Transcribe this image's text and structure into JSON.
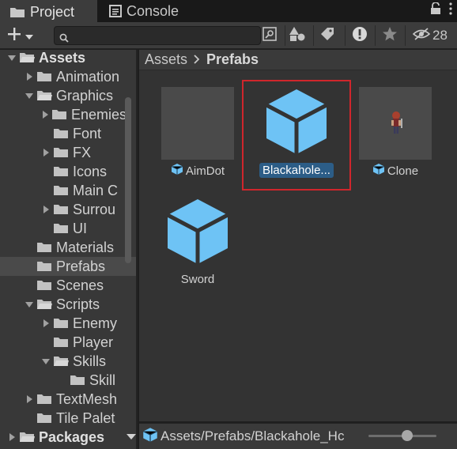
{
  "tabs": {
    "project_label": "Project",
    "console_label": "Console"
  },
  "toolbar": {
    "create_label": "+",
    "search_placeholder": "",
    "hidden_count": "28"
  },
  "tree": {
    "items": [
      {
        "label": "Assets"
      },
      {
        "label": "Animation"
      },
      {
        "label": "Graphics"
      },
      {
        "label": "Enemies"
      },
      {
        "label": "Font"
      },
      {
        "label": "FX"
      },
      {
        "label": "Icons"
      },
      {
        "label": "Main C"
      },
      {
        "label": "Surrou"
      },
      {
        "label": "UI"
      },
      {
        "label": "Materials"
      },
      {
        "label": "Prefabs"
      },
      {
        "label": "Scenes"
      },
      {
        "label": "Scripts"
      },
      {
        "label": "Enemy"
      },
      {
        "label": "Player"
      },
      {
        "label": "Skills"
      },
      {
        "label": "Skill"
      },
      {
        "label": "TextMesh"
      },
      {
        "label": "Tile Palet"
      },
      {
        "label": "Packages"
      }
    ]
  },
  "breadcrumb": {
    "root": "Assets",
    "current": "Prefabs"
  },
  "assets": [
    {
      "name": "AimDot"
    },
    {
      "name": "Blackahole..."
    },
    {
      "name": "Clone"
    },
    {
      "name": "Sword"
    }
  ],
  "footer": {
    "path": "Assets/Prefabs/Blackahole_Hc"
  },
  "colors": {
    "accent_selection": "#2c5d87",
    "highlight_border": "#d0262c",
    "prefab_cube": "#6ec3f5"
  }
}
